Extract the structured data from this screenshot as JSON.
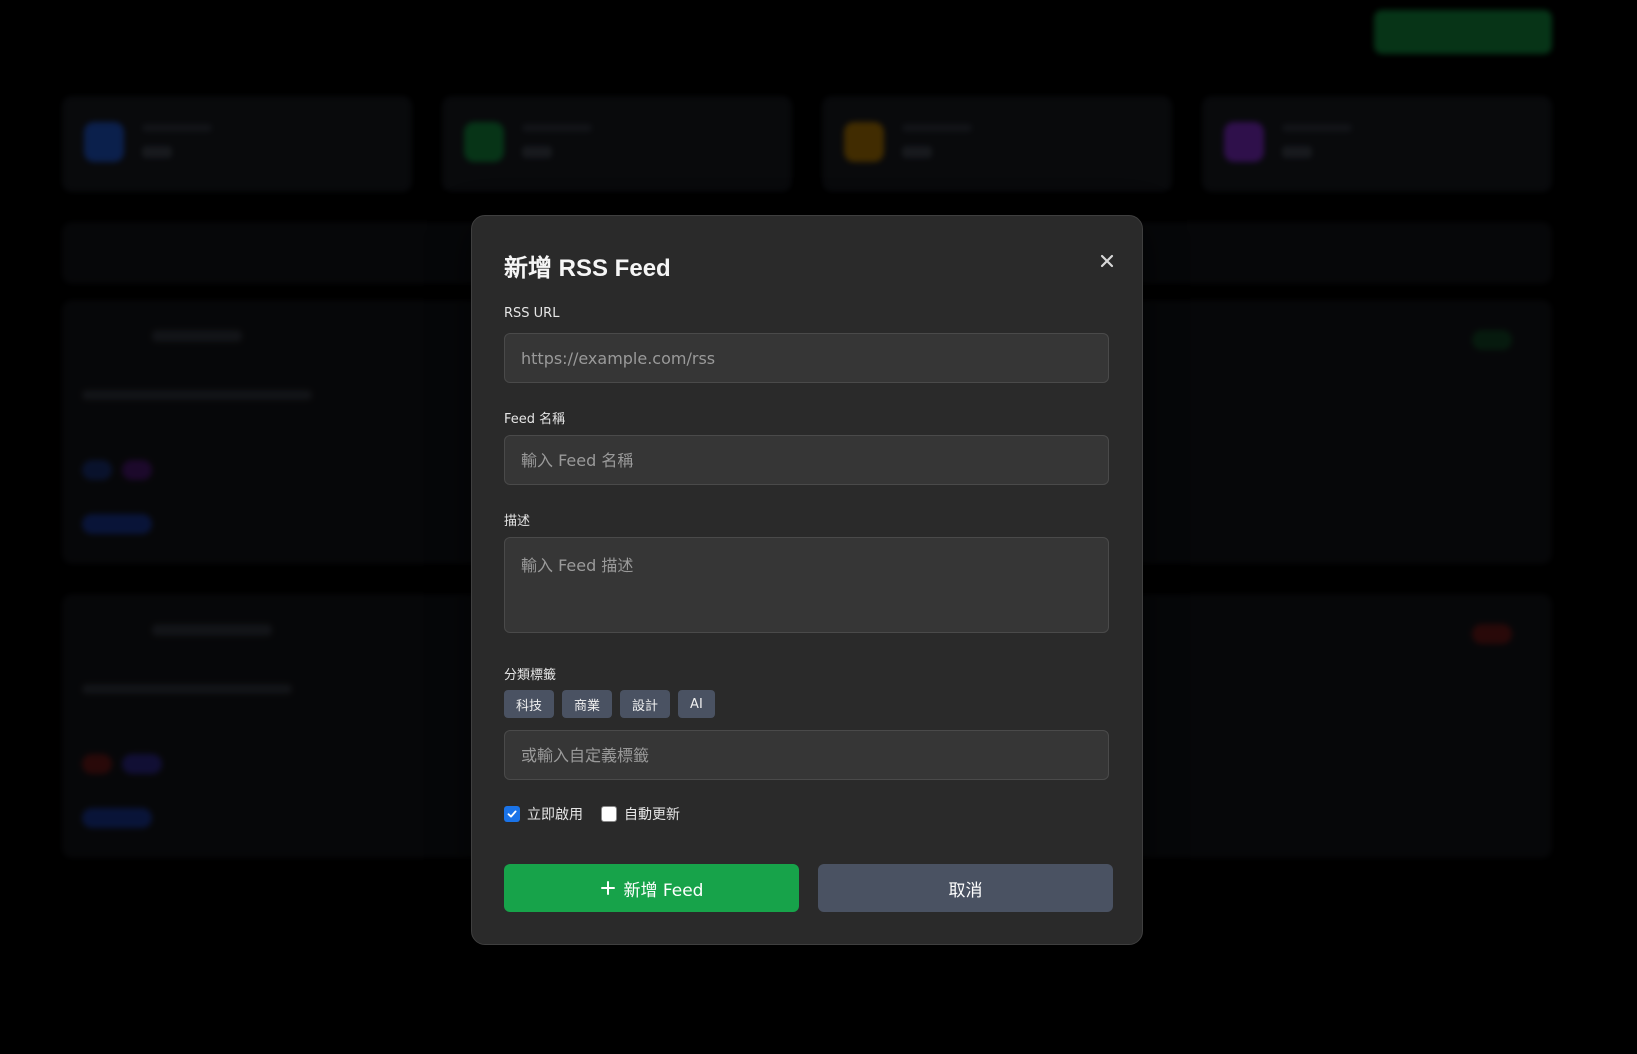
{
  "modal": {
    "title": "新增 RSS Feed",
    "close_icon": "close-icon",
    "fields": {
      "url": {
        "label": "RSS URL",
        "placeholder": "https://example.com/rss",
        "value": ""
      },
      "name": {
        "label": "Feed 名稱",
        "placeholder": "輸入 Feed 名稱",
        "value": ""
      },
      "description": {
        "label": "描述",
        "placeholder": "輸入 Feed 描述",
        "value": ""
      },
      "tags": {
        "label": "分類標籤",
        "options": [
          "科技",
          "商業",
          "設計",
          "AI"
        ],
        "custom_placeholder": "或輸入自定義標籤",
        "custom_value": ""
      }
    },
    "checkboxes": [
      {
        "label": "立即啟用",
        "checked": true
      },
      {
        "label": "自動更新",
        "checked": false
      }
    ],
    "buttons": {
      "submit": {
        "label": "新增 Feed",
        "icon": "plus-icon",
        "color": "#17a34a"
      },
      "cancel": {
        "label": "取消",
        "color": "#4a5262"
      }
    }
  },
  "colors": {
    "backdrop": "#000000",
    "modal_bg": "#2a2a2a",
    "input_bg": "#363636",
    "tag_bg": "#4a5262",
    "checkbox_accent": "#1a73e8"
  }
}
